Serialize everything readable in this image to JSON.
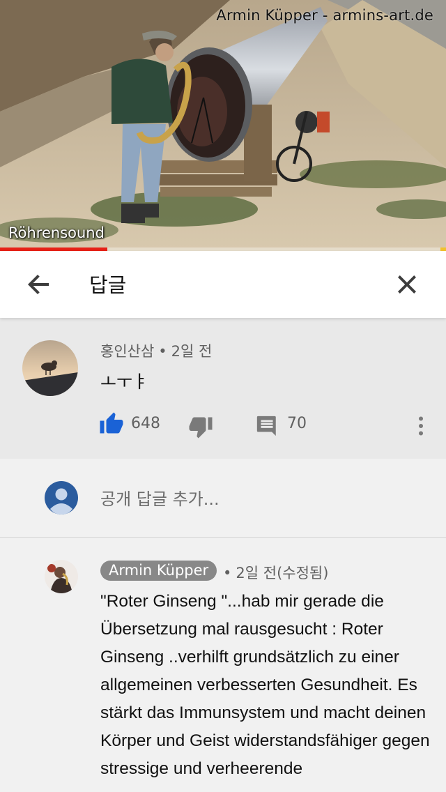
{
  "video": {
    "watermark": "Armin Küpper - armins-art.de",
    "caption": "Röhrensound",
    "progress": 0.24,
    "colors": {
      "progress": "#e62117"
    }
  },
  "header": {
    "back_icon": "arrow-left-icon",
    "title": "답글",
    "close_icon": "close-icon"
  },
  "parent_comment": {
    "author": "홍인산삼",
    "time": "2일 전",
    "separator": "•",
    "text": "ㅗㅜㅑ",
    "likes": "648",
    "replies": "70",
    "icons": [
      "thumb-up-icon",
      "thumb-down-icon",
      "comment-icon",
      "more-vert-icon"
    ],
    "colors": {
      "like": "#1a62d6"
    }
  },
  "add_reply": {
    "placeholder": "공개 답글 추가...",
    "avatar_icon": "user-avatar-icon"
  },
  "reply": {
    "author": "Armin Küpper",
    "separator": "•",
    "time": "2일 전(수정됨)",
    "text": "\"Roter Ginseng \"...hab mir gerade die Übersetzung mal rausgesucht : Roter Ginseng ..verhilft grundsätzlich zu einer allgemeinen verbesserten Gesundheit. Es stärkt das Immunsystem und macht deinen Körper und Geist widerstandsfähiger gegen stressige und verheerende"
  }
}
